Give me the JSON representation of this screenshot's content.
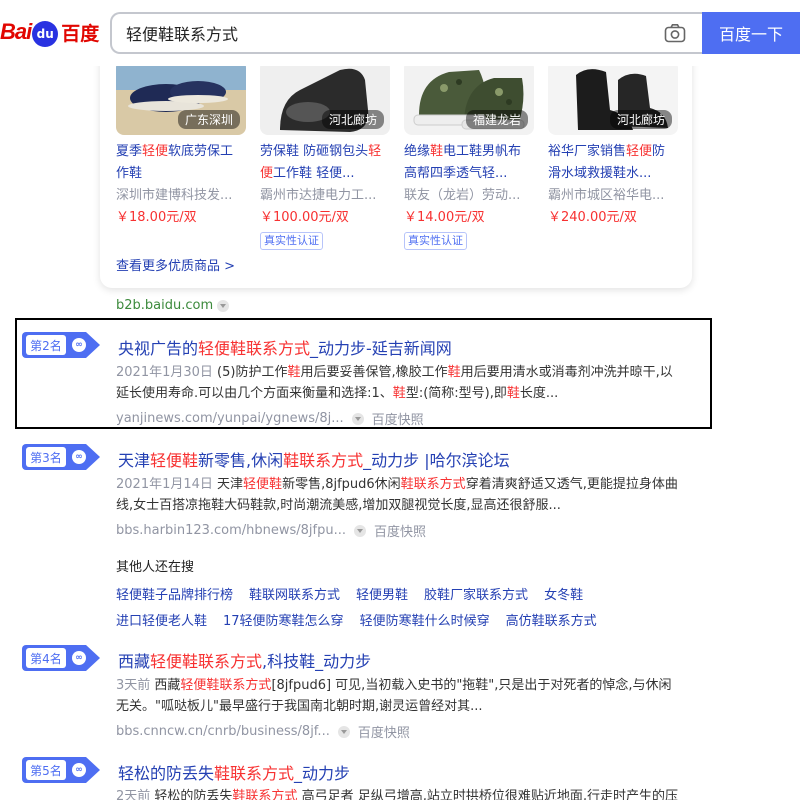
{
  "header": {
    "logo_bai": "Bai",
    "logo_paw": "du",
    "logo_du": "百度",
    "search_value": "轻便鞋联系方式",
    "search_button": "百度一下",
    "icons": {
      "camera": "camera-icon"
    }
  },
  "products": [
    {
      "location": "广东深圳",
      "title_pre": "夏季",
      "title_hl": "轻便",
      "title_post": "软底劳保工作鞋",
      "seller": "深圳市建博科技发...",
      "price": "￥18.00元/双",
      "badge": ""
    },
    {
      "location": "河北廊坊",
      "title_pre": "劳保鞋 防砸钢包头",
      "title_hl": "轻便",
      "title_post": "工作鞋 轻便...",
      "seller": "霸州市达捷电力工...",
      "price": "￥100.00元/双",
      "badge": "真实性认证"
    },
    {
      "location": "福建龙岩",
      "title_pre": "绝缘",
      "title_hl": "鞋",
      "title_post": "电工鞋男帆布高帮四季透气轻...",
      "seller": "联友（龙岩）劳动...",
      "price": "￥14.00元/双",
      "badge": "真实性认证"
    },
    {
      "location": "河北廊坊",
      "title_pre": "裕华厂家销售",
      "title_hl": "轻便",
      "title_post": "防滑水域救援鞋水...",
      "seller": "霸州市城区裕华电...",
      "price": "￥240.00元/双",
      "badge": ""
    }
  ],
  "more_goods": "查看更多优质商品 >",
  "b2b_url": "b2b.baidu.com",
  "results": [
    {
      "rank": "第2名",
      "title_pre": "央视广告的",
      "title_hl": "轻便鞋联系方式",
      "title_post": "_动力步-延吉新闻网",
      "date": "2021年1月30日",
      "desc_1": " (5)防护工作",
      "desc_hl1": "鞋",
      "desc_2": "用后要妥善保管,橡胶工作",
      "desc_hl2": "鞋",
      "desc_3": "用后要用清水或消毒剂冲洗并晾干,以延长使用寿命.可以由几个方面来衡量和选择:1、",
      "desc_hl3": "鞋",
      "desc_4": "型:(简称:型号),即",
      "desc_hl4": "鞋",
      "desc_5": "长度...",
      "url": "yanjinews.com/yunpai/ygnews/8j...",
      "snapshot": "百度快照"
    },
    {
      "rank": "第3名",
      "title_pre": "天津",
      "title_hl": "轻便鞋",
      "title_mid": "新零售,休闲",
      "title_hl2": "鞋联系方式",
      "title_post": "_动力步 |哈尔滨论坛",
      "date": "2021年1月14日",
      "desc_1": " 天津",
      "desc_hl1": "轻便鞋",
      "desc_2": "新零售,8jfpud6休闲",
      "desc_hl2": "鞋联系方式",
      "desc_3": "穿着清爽舒适又透气,更能提拉身体曲线,女士百搭凉拖鞋大码鞋款,时尚潮流美感,增加双腿视觉长度,显高还很舒服...",
      "url": "bbs.harbin123.com/hbnews/8jfpu...",
      "snapshot": "百度快照"
    },
    {
      "rank": "第4名",
      "title_pre": "西藏",
      "title_hl": "轻便鞋联系方式",
      "title_post": ",科技鞋_动力步",
      "date": "3天前",
      "desc_1": " 西藏",
      "desc_hl1": "轻便鞋联系方式",
      "desc_2": "[8jfpud6] 可见,当初载入史书的\"拖鞋\",只是出于对死者的悼念,与休闲无关。\"呱哒板儿\"最早盛行于我国南北朝时期,谢灵运曾经对其...",
      "url": "bbs.cnncw.cn/cnrb/business/8jf...",
      "snapshot": "百度快照"
    },
    {
      "rank": "第5名",
      "title_pre": "轻松的防丢失",
      "title_hl": "鞋联系方式",
      "title_post": "_动力步",
      "date": "2天前",
      "desc_1": " 轻松的防丢失",
      "desc_hl1": "鞋联系方式",
      "desc_2": " 高弓足者 足纵弓增高,站立时拱桥位很难贴近地面,行走时产生的压",
      "url": "",
      "snapshot": ""
    }
  ],
  "related": {
    "title": "其他人还在搜",
    "row1": [
      "轻便鞋子品牌排行榜",
      "鞋联网联系方式",
      "轻便男鞋",
      "胶鞋厂家联系方式",
      "女冬鞋"
    ],
    "row2": [
      "进口轻便老人鞋",
      "17轻便防寒鞋怎么穿",
      "轻便防寒鞋什么时候穿",
      "高仿鞋联系方式"
    ]
  }
}
